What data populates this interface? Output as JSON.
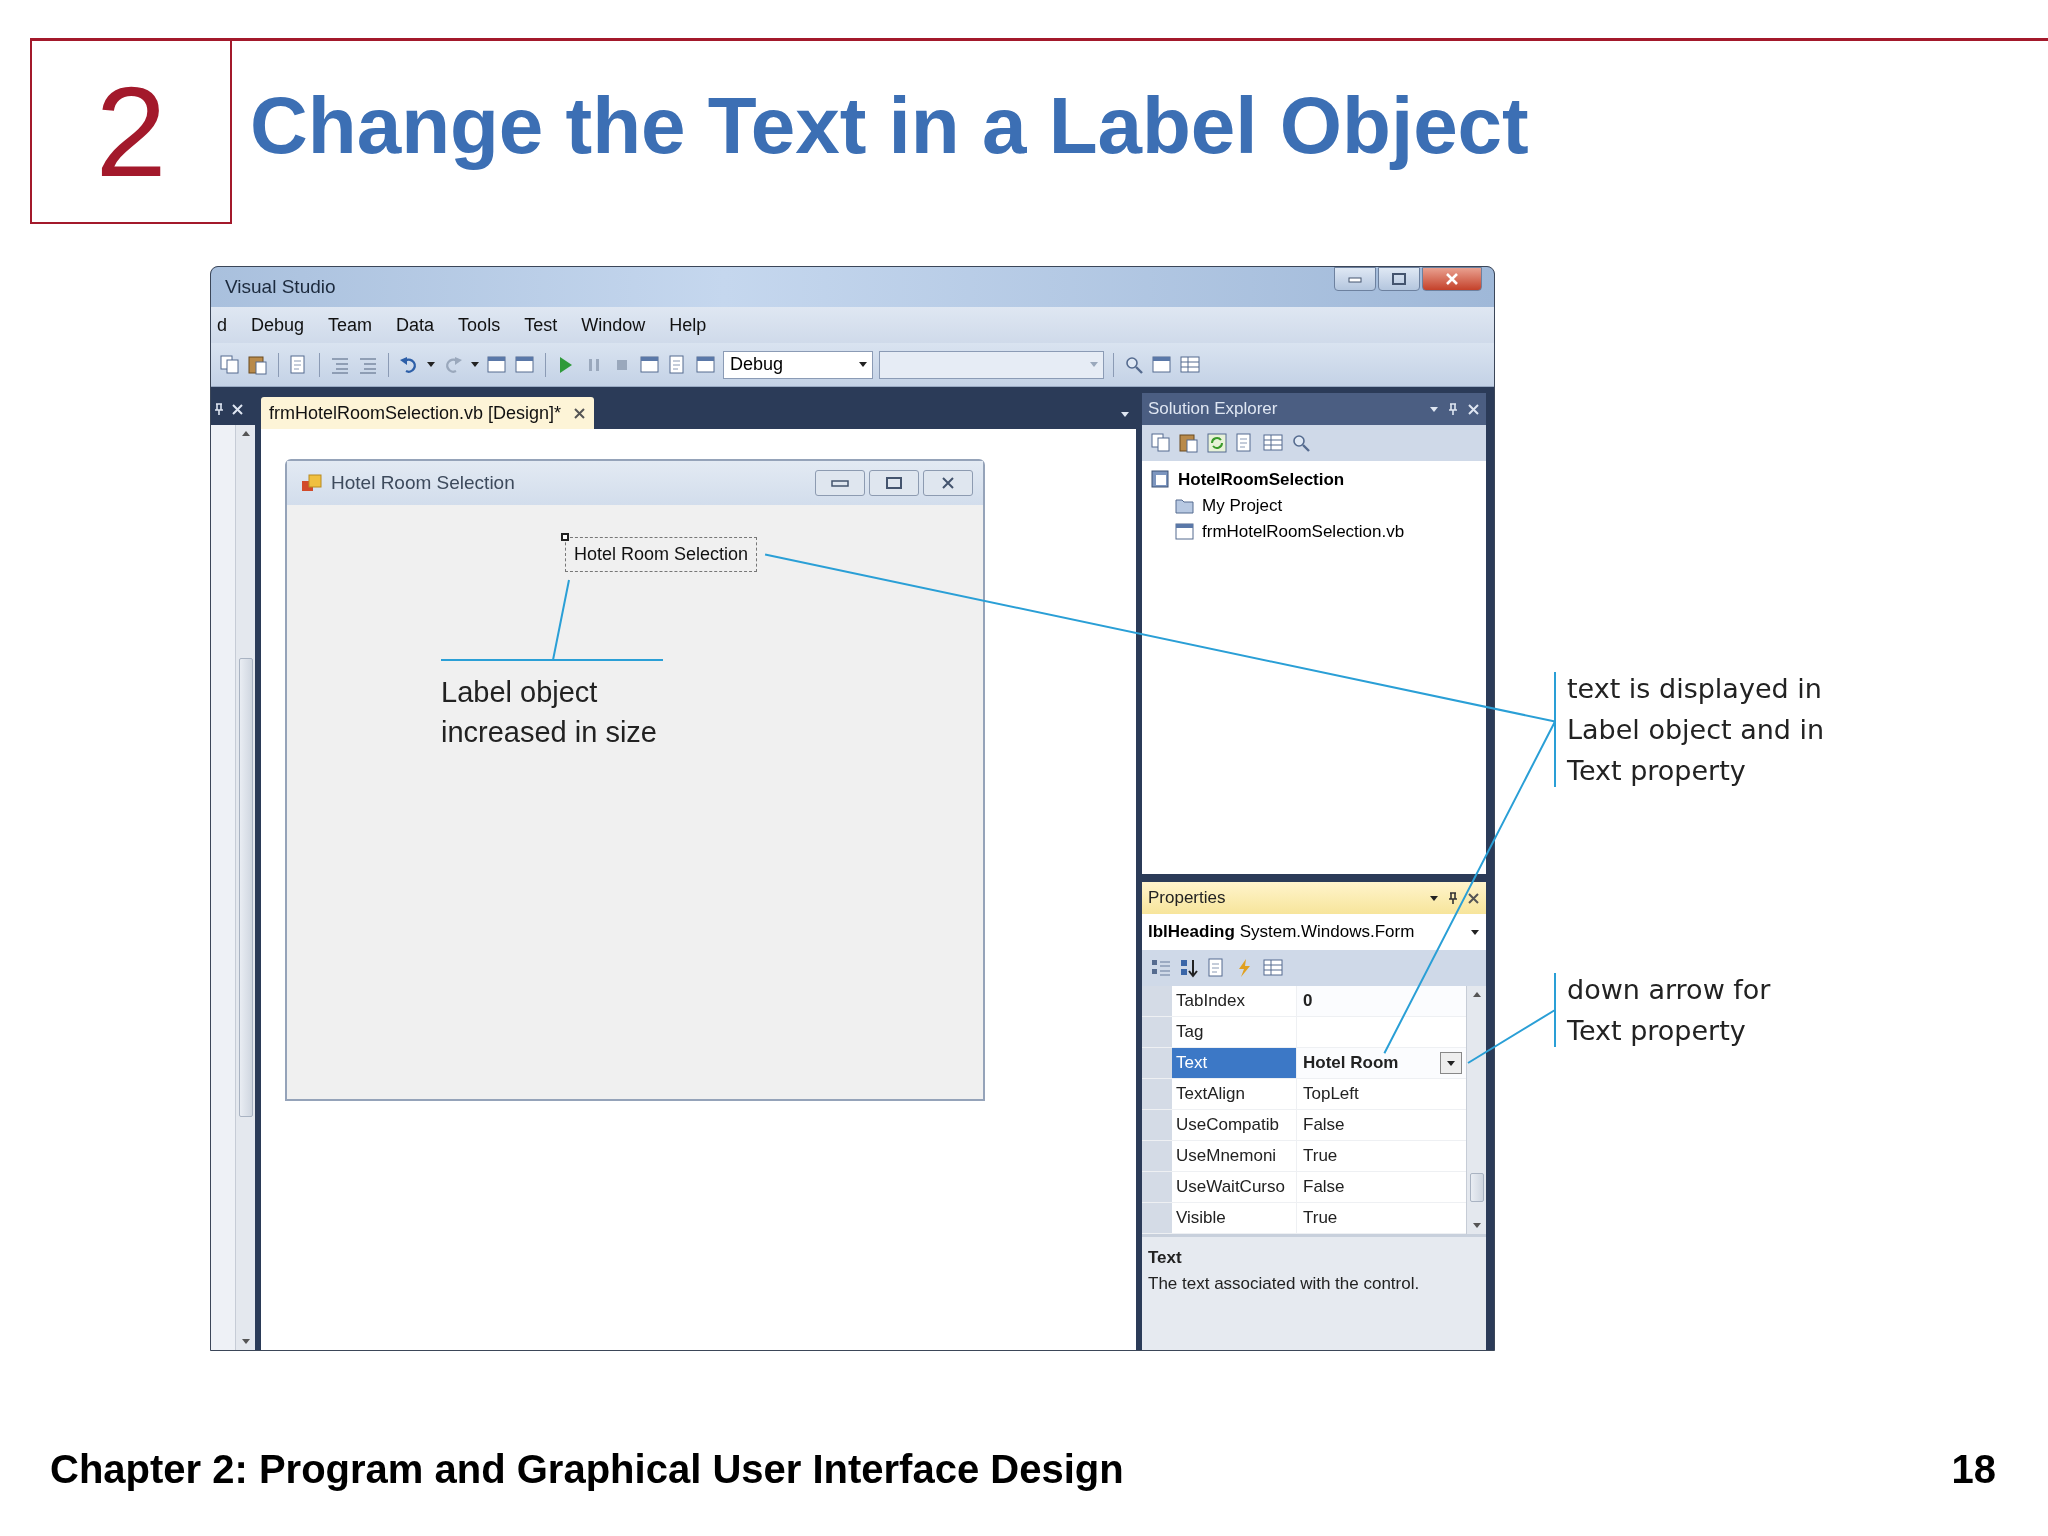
{
  "slide": {
    "number": "2",
    "title": "Change the Text in a Label Object",
    "footer": "Chapter 2: Program and Graphical User Interface Design",
    "page": "18"
  },
  "ide": {
    "title": "Visual Studio",
    "menu": [
      "d",
      "Debug",
      "Team",
      "Data",
      "Tools",
      "Test",
      "Window",
      "Help"
    ],
    "configuration": "Debug",
    "document_tab": {
      "label": "frmHotelRoomSelection.vb [Design]*",
      "selected": true
    },
    "form": {
      "title": "Hotel Room Selection",
      "label": "Hotel Room Selection"
    },
    "solution_explorer": {
      "title": "Solution Explorer",
      "tree": [
        {
          "label": "HotelRoomSelection",
          "kind": "project",
          "children": [
            {
              "label": "My Project",
              "kind": "folder"
            },
            {
              "label": "frmHotelRoomSelection.vb",
              "kind": "form"
            }
          ]
        }
      ]
    },
    "properties": {
      "title": "Properties",
      "object": "**lblHeading** System.Windows.Form",
      "rows": [
        {
          "name": "TabIndex",
          "value": "0",
          "modified": true,
          "selected": false,
          "dropdown": false
        },
        {
          "name": "Tag",
          "modified": false,
          "selected": false,
          "dropdown": false
        },
        {
          "name": "Text",
          "value": "Hotel Room",
          "modified": true,
          "selected": true,
          "dropdown": true
        },
        {
          "name": "TextAlign",
          "value": "TopLeft",
          "modified": false,
          "selected": false,
          "dropdown": false
        },
        {
          "name": "UseCompatib",
          "value": "False",
          "modified": false,
          "selected": false,
          "dropdown": false
        },
        {
          "name": "UseMnemoni",
          "value": "True",
          "modified": false,
          "selected": false,
          "dropdown": false
        },
        {
          "name": "UseWaitCurso",
          "value": "False",
          "modified": false,
          "selected": false,
          "dropdown": false
        },
        {
          "name": "Visible",
          "value": "True",
          "modified": false,
          "selected": false,
          "dropdown": false
        }
      ],
      "description_title": "Text",
      "description": "The text associated with the control."
    }
  },
  "callouts": [
    {
      "lines": [
        "Label object",
        "increased in size"
      ]
    },
    {
      "lines": [
        "text is displayed in",
        "Label object and in",
        "Text property"
      ]
    },
    {
      "lines": [
        "down arrow for",
        "Text property"
      ]
    }
  ]
}
